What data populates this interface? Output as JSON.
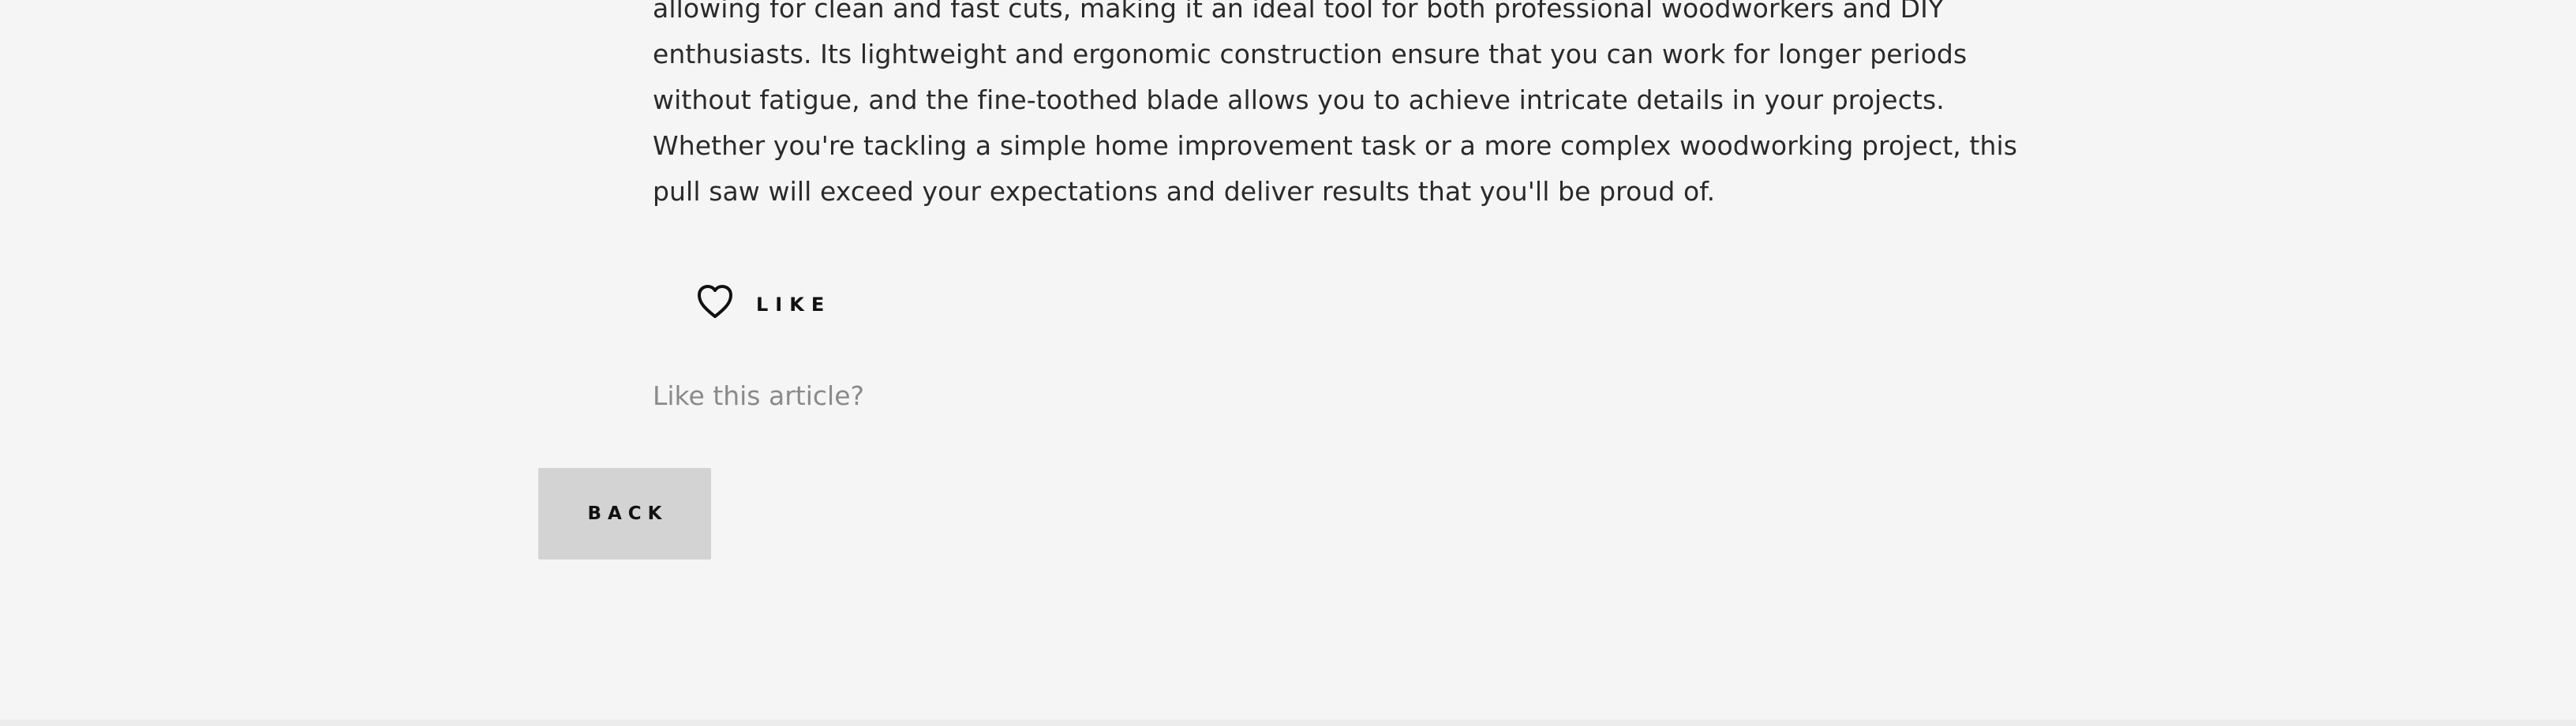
{
  "article": {
    "lines": [
      "allowing for clean and fast cuts, making it an ideal tool for both professional woodworkers and DIY",
      "enthusiasts. Its lightweight and ergonomic construction ensure that you can work for longer periods",
      "without fatigue, and the fine-toothed blade allows you to achieve intricate details in your projects.",
      "Whether you're tackling a simple home improvement task or a more complex woodworking project, this",
      "pull saw will exceed your expectations and deliver results that you'll be proud of."
    ]
  },
  "like": {
    "icon": "heart-outline-icon",
    "label": "LIKE"
  },
  "like_prompt": "Like this article?",
  "back_button": {
    "label": "BACK"
  },
  "colors": {
    "background": "#f5f5f5",
    "text": "#2a2a2a",
    "muted_text": "#8a8a8a",
    "button_bg": "#d3d3d3"
  }
}
